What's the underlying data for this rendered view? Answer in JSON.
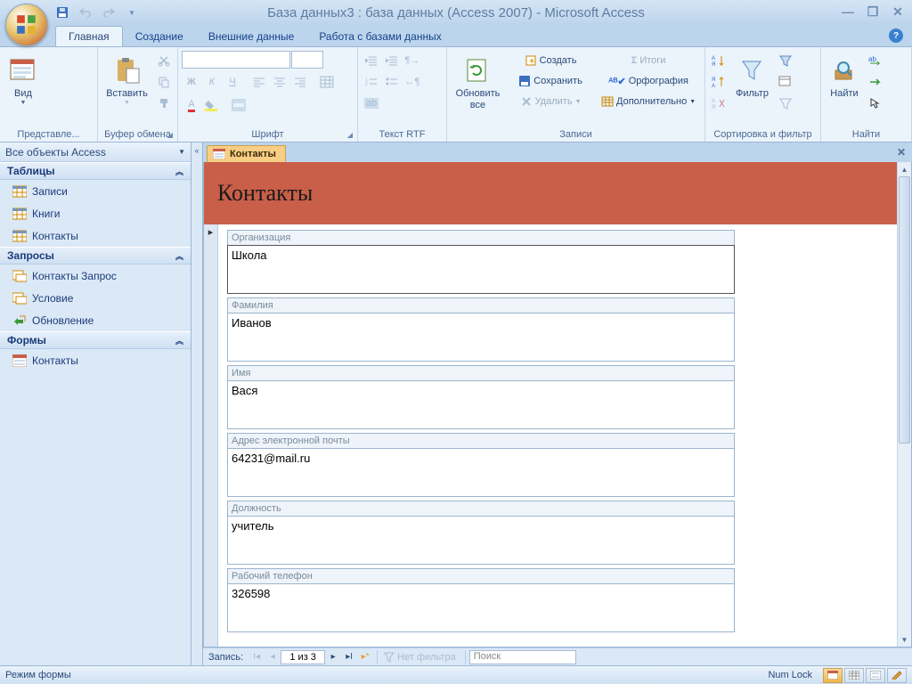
{
  "title": "База данных3 : база данных (Access 2007) - Microsoft Access",
  "tabs": {
    "home": "Главная",
    "create": "Создание",
    "external": "Внешние данные",
    "dbtools": "Работа с базами данных"
  },
  "ribbon": {
    "views": {
      "view": "Вид",
      "label": "Представле..."
    },
    "clipboard": {
      "paste": "Вставить",
      "label": "Буфер обмена"
    },
    "font": {
      "label": "Шрифт"
    },
    "rtf": {
      "label": "Текст RTF"
    },
    "records": {
      "refresh": "Обновить\nвсе",
      "new": "Создать",
      "save": "Сохранить",
      "delete": "Удалить",
      "totals": "Итоги",
      "spell": "Орфография",
      "more": "Дополнительно",
      "label": "Записи"
    },
    "sortfilter": {
      "filter": "Фильтр",
      "label": "Сортировка и фильтр"
    },
    "find": {
      "find": "Найти",
      "label": "Найти"
    }
  },
  "nav": {
    "title": "Все объекты Access",
    "sections": [
      {
        "title": "Таблицы",
        "items": [
          "Записи",
          "Книги",
          "Контакты"
        ],
        "icon": "table"
      },
      {
        "title": "Запросы",
        "items": [
          "Контакты Запрос",
          "Условие",
          "Обновление"
        ],
        "icon": "query"
      },
      {
        "title": "Формы",
        "items": [
          "Контакты"
        ],
        "icon": "form"
      }
    ]
  },
  "doc": {
    "tab": "Контакты",
    "title": "Контакты"
  },
  "form": {
    "fields": [
      {
        "label": "Организация",
        "value": "Школа"
      },
      {
        "label": "Фамилия",
        "value": "Иванов"
      },
      {
        "label": "Имя",
        "value": "Вася"
      },
      {
        "label": "Адрес электронной почты",
        "value": "64231@mail.ru"
      },
      {
        "label": "Должность",
        "value": "учитель"
      },
      {
        "label": "Рабочий телефон",
        "value": "326598"
      }
    ]
  },
  "recnav": {
    "label": "Запись:",
    "pos": "1 из 3",
    "filter": "Нет фильтра",
    "search": "Поиск"
  },
  "status": {
    "mode": "Режим формы",
    "numlock": "Num Lock"
  }
}
